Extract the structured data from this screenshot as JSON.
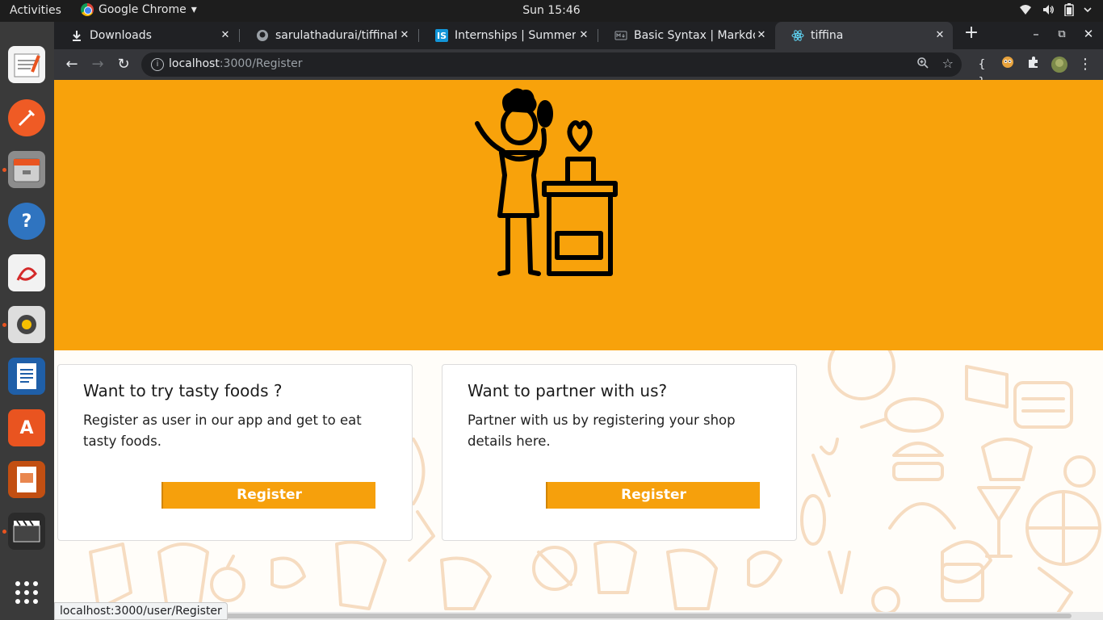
{
  "topbar": {
    "activities": "Activities",
    "app_name": "Google Chrome",
    "app_menu_arrow": "▾",
    "clock": "Sun 15:46",
    "icons": [
      "wifi-icon",
      "volume-icon",
      "battery-icon",
      "power-menu-icon"
    ]
  },
  "dock": {
    "items": [
      "text-editor",
      "postman",
      "file-manager",
      "help",
      "pdf-viewer",
      "rhythmbox",
      "libreoffice-writer",
      "software-center",
      "libreoffice-impress",
      "video-editor",
      "show-applications"
    ]
  },
  "tabs": [
    {
      "title": "Downloads",
      "favicon": "download-icon"
    },
    {
      "title": "sarulathadurai/tiffinaf",
      "favicon": "github-icon"
    },
    {
      "title": "Internships | Summer Ir",
      "favicon": "IS"
    },
    {
      "title": "Basic Syntax | Markdow",
      "favicon": "markdown-icon"
    },
    {
      "title": "tiffina",
      "favicon": "react-icon"
    }
  ],
  "toolbar": {
    "url_host": "localhost",
    "url_path": ":3000/Register"
  },
  "page": {
    "user_card": {
      "heading": "Want to try tasty foods ?",
      "text": "Register as user in our app and get to eat tasty foods.",
      "button": "Register"
    },
    "partner_card": {
      "heading": "Want to partner with us?",
      "text": "Partner with us by registering your shop details here.",
      "button": "Register"
    }
  },
  "status_url": "localhost:3000/user/Register",
  "colors": {
    "hero": "#f8a20b",
    "button": "#f6a00c",
    "pattern": "#f6dcc1"
  }
}
